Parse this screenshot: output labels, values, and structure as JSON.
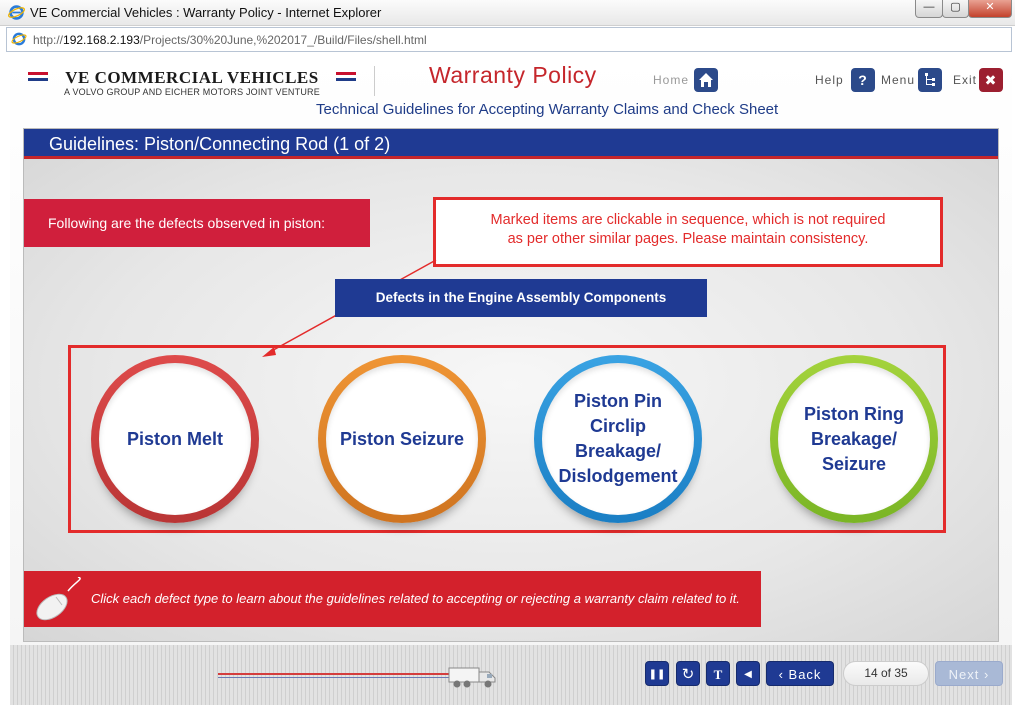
{
  "browser": {
    "window_title": "VE Commercial Vehicles : Warranty Policy - Internet Explorer",
    "url_prefix": "http://",
    "url_host": "192.168.2.193",
    "url_path": "/Projects/30%20June,%202017_/Build/Files/shell.html",
    "close_glyph": "✕",
    "min_glyph": "—",
    "max_glyph": "▢"
  },
  "header": {
    "brand_name": "VE COMMERCIAL VEHICLES",
    "brand_tagline": "A VOLVO GROUP AND EICHER MOTORS JOINT VENTURE",
    "course_title": "Warranty Policy",
    "course_subtitle": "Technical Guidelines for Accepting Warranty Claims and Check Sheet",
    "nav": {
      "home_label": "Home",
      "help_label": "Help",
      "help_glyph": "?",
      "menu_label": "Menu",
      "exit_label": "Exit",
      "exit_glyph": "✖"
    }
  },
  "slide": {
    "title": "Guidelines: Piston/Connecting Rod (1 of 2)",
    "intro": "Following are the defects observed in piston:",
    "review_note_line1": "Marked items are clickable in sequence, which is not required",
    "review_note_line2": "as per other similar pages. Please maintain consistency.",
    "defects_heading": "Defects in the Engine Assembly Components",
    "defects": [
      {
        "lines": [
          "Piston Melt"
        ],
        "color": "#d64545"
      },
      {
        "lines": [
          "Piston Seizure"
        ],
        "color": "#e8892c"
      },
      {
        "lines": [
          "Piston Pin",
          "Circlip",
          "Breakage/",
          "Dislodgement"
        ],
        "color": "#2a93d6"
      },
      {
        "lines": [
          "Piston Ring",
          "Breakage/",
          "Seizure"
        ],
        "color": "#92c832"
      }
    ],
    "instruction": "Click each defect type to learn about the guidelines related to accepting or rejecting a warranty claim related to it."
  },
  "footer": {
    "pause_glyph": "❚❚",
    "replay_glyph": "↻",
    "transcript_glyph": "T",
    "audio_glyph": "◀",
    "back_label": "‹ Back",
    "page_counter": "14 of 35",
    "next_label": "Next ›"
  },
  "colors": {
    "brand_blue": "#1f3a93",
    "brand_red": "#d01f3c",
    "review_red": "#e32b2b"
  }
}
